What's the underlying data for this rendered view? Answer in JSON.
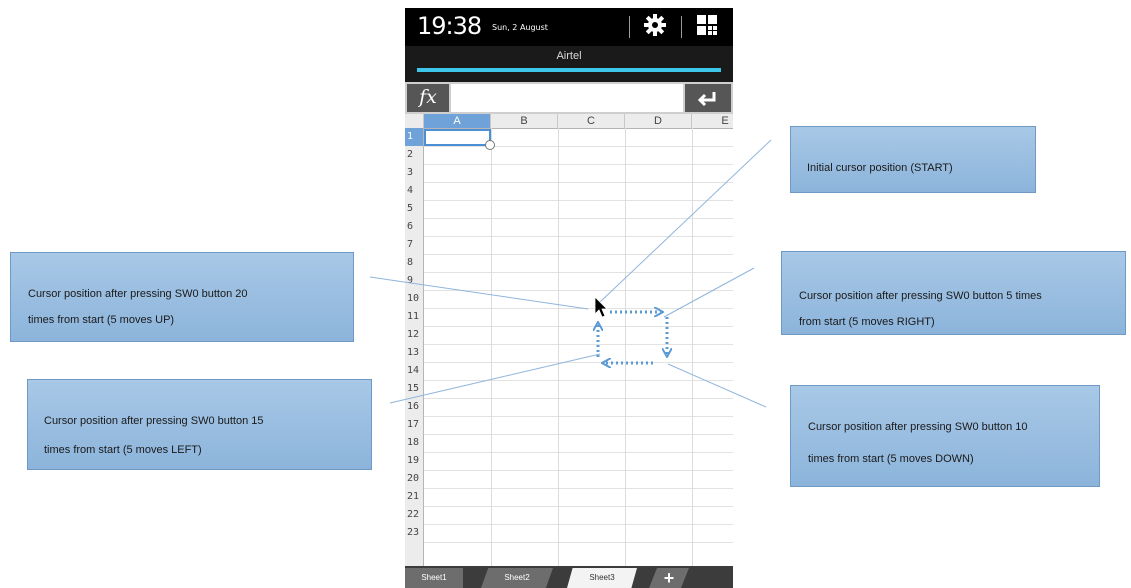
{
  "status_bar": {
    "time": "19:38",
    "date": "Sun, 2 August",
    "icons": [
      "gear-icon",
      "grid-icon"
    ]
  },
  "carrier": "Airtel",
  "formula_bar": {
    "fx_label": "fx",
    "value": "",
    "enter_icon": "enter-icon"
  },
  "spreadsheet": {
    "columns": [
      "A",
      "B",
      "C",
      "D",
      "E"
    ],
    "rows": [
      "1",
      "2",
      "3",
      "4",
      "5",
      "6",
      "7",
      "8",
      "9",
      "10",
      "11",
      "12",
      "13",
      "14",
      "15",
      "16",
      "17",
      "18",
      "19",
      "20",
      "21",
      "22",
      "23"
    ],
    "selected_cell": "A1"
  },
  "sheet_tabs": [
    "Sheet1",
    "Sheet2",
    "Sheet3"
  ],
  "add_tab_label": "+",
  "callouts": {
    "start": "Initial cursor position (START)",
    "up_line1": "Cursor position after pressing SW0 button 20",
    "up_line2": "times from start (5 moves UP)",
    "right_line1": "Cursor position after pressing SW0 button 5 times",
    "right_line2": "from start   (5 moves RIGHT)",
    "left_line1": "Cursor position after pressing SW0 button 15",
    "left_line2": "times from start (5 moves LEFT)",
    "down_line1": "Cursor position after pressing SW0 button 10",
    "down_line2": "times from start  (5 moves DOWN)"
  },
  "colors": {
    "accent_line": "#3dc5ea",
    "callout_fill": "#9dbfe3",
    "arrow_color": "#5b9bd5",
    "selection_border": "#4b8fd6"
  }
}
